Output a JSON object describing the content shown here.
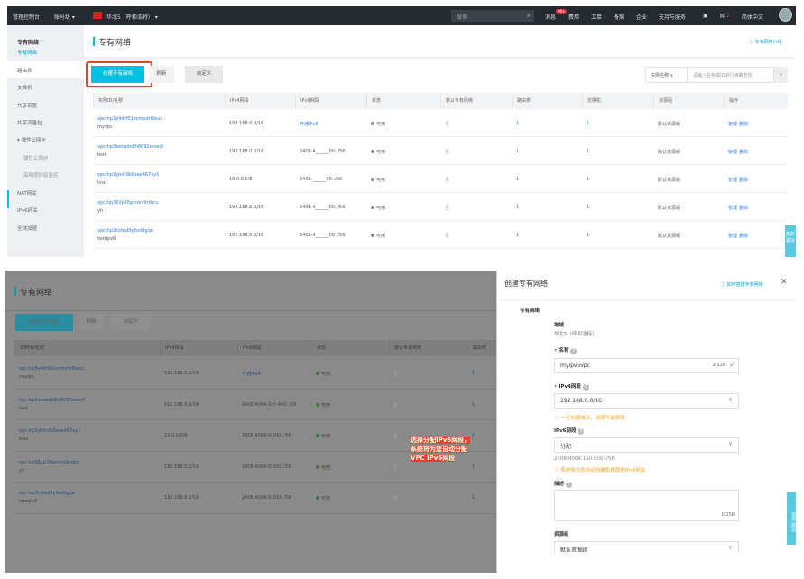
{
  "top": {
    "console": "管理控制台",
    "account": "账号级 ▾",
    "region": "华北5（呼和浩特） ▾",
    "search_placeholder": "搜索",
    "messages": "消息",
    "badge": "99+",
    "nav": [
      "费用",
      "工单",
      "备案",
      "企业",
      "支持与服务"
    ],
    "cart_count": "2",
    "language": "简体中文"
  },
  "sidebar": {
    "title": "专有网络",
    "items": [
      "专有网络",
      "路由表",
      "交换机",
      "共享带宽",
      "共享流量包",
      "▾ 弹性公网IP",
      "弹性公网IP",
      "高精度秒级监控",
      "NAT网关",
      "IPv6网关",
      "全球加速"
    ]
  },
  "main": {
    "title": "专有网络",
    "help": "专有网络介绍",
    "create": "创建专有网络",
    "refresh": "刷新",
    "customize": "自定义",
    "filter": "实例名称",
    "filter_placeholder": "请输入名称或ID进行精确查询"
  },
  "columns": [
    "实例ID/名称",
    "IPv4网段",
    "IPv6网段",
    "状态",
    "默认专有网络",
    "路由表",
    "交换机",
    "资源组",
    "操作"
  ],
  "rows": [
    {
      "id": "vpc-hp3v4drf01ecmxdr6leuc",
      "name": "myvpc",
      "ipv4": "192.168.0.0/16",
      "ipv6": "开通IPv6",
      "ipv6_full": "开通IPv6",
      "status": "可用",
      "default": "否",
      "rt": "1",
      "vsw": "1",
      "rg": "默认资源组",
      "manage": "管理",
      "del": "删除"
    },
    {
      "id": "vpc-hp3eetwdo8h8092onon6",
      "name": "test",
      "ipv4": "192.168.0.0/16",
      "ipv6": "2408:4______00::/56",
      "ipv6_full": "2408:4004:1c0:400::/56",
      "status": "可用",
      "default": "否",
      "rt": "1",
      "vsw": "1",
      "rg": "默认资源组",
      "manage": "管理",
      "del": "删除"
    },
    {
      "id": "vpc-hp3ybitr9k6sae467xy1",
      "name": "linsi",
      "ipv4": "10.0.0.0/8",
      "ipv6": "2408:______00::/56",
      "ipv6_full": "2408:4004:0:800::/56",
      "status": "可用",
      "default": "否",
      "rt": "1",
      "vsw": "1",
      "rg": "默认资源组",
      "manage": "管理",
      "del": "删除"
    },
    {
      "id": "vpc-hp362p76pzreiv9rsbru",
      "name": "yh",
      "ipv4": "192.168.0.0/16",
      "ipv6": "2408:4______00::/56",
      "ipv6_full": "2408:4004:0:900::/56",
      "status": "可用",
      "default": "否",
      "rt": "1",
      "vsw": "1",
      "rg": "默认资源组",
      "manage": "管理",
      "del": "删除"
    },
    {
      "id": "vpc-hp3kzlwd9yfssfdgqe",
      "name": "testipv6",
      "ipv4": "192.168.0.0/16",
      "ipv6": "2408:4______00::/56",
      "ipv6_full": "2408:4004:0:200::/56",
      "status": "可用",
      "default": "否",
      "rt": "1",
      "vsw": "1",
      "rg": "默认资源组",
      "manage": "管理",
      "del": "删除"
    }
  ],
  "drawer": {
    "title": "创建专有网络",
    "help": "如何搭建专有网络",
    "section": "专有网络",
    "region_label": "地域",
    "region_value": "华北5（呼和浩特）",
    "name_label": "名称",
    "name_value": "myipv6vpc",
    "name_count": "9/128",
    "ipv4_label": "IPv4网段",
    "ipv4_value": "192.168.0.0/16",
    "ipv4_warn": "一旦创建成功，网段不能修改",
    "ipv6_label": "IPv6网段",
    "ipv6_value": "分配",
    "ipv6_hint": "2408:4004:1a0:d00::/56",
    "ipv6_warn": "系统将为您自动创建免费版的IPv6网关",
    "desc_label": "描述",
    "desc_count": "0/256",
    "rg_label": "资源组",
    "rg_value": "默认资源组"
  },
  "annotation": "选择分配IPv6网段，系统将为您自动分配VPC IPv6网段",
  "feedback": "咨询·建议",
  "colors": {
    "accent": "#00c1de",
    "highlight": "#e8402a"
  }
}
